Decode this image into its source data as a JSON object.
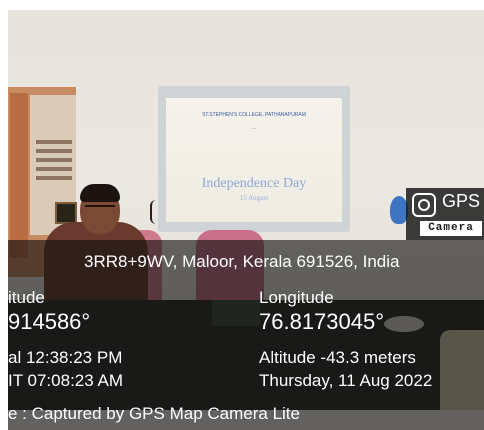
{
  "gps_badge": {
    "title": "GPS",
    "subtitle": "Camera",
    "icon": "camera-icon"
  },
  "photo": {
    "board_heading": "ST.STEPHEN'S COLLEGE, PATHANAPURAM",
    "board_subheading": "...",
    "board_title": "Independence Day",
    "board_date": "15 August"
  },
  "location": {
    "address": "3RR8+9WV, Maloor, Kerala 691526, India",
    "latitude_label": "itude",
    "latitude_value": "914586°",
    "longitude_label": "Longitude",
    "longitude_value": "76.8173045°",
    "local_time": "al 12:38:23 PM",
    "gmt_time": "IT 07:08:23 AM",
    "altitude": "Altitude -43.3 meters",
    "date": "Thursday, 11 Aug 2022",
    "note": "e : Captured by GPS Map Camera Lite"
  }
}
